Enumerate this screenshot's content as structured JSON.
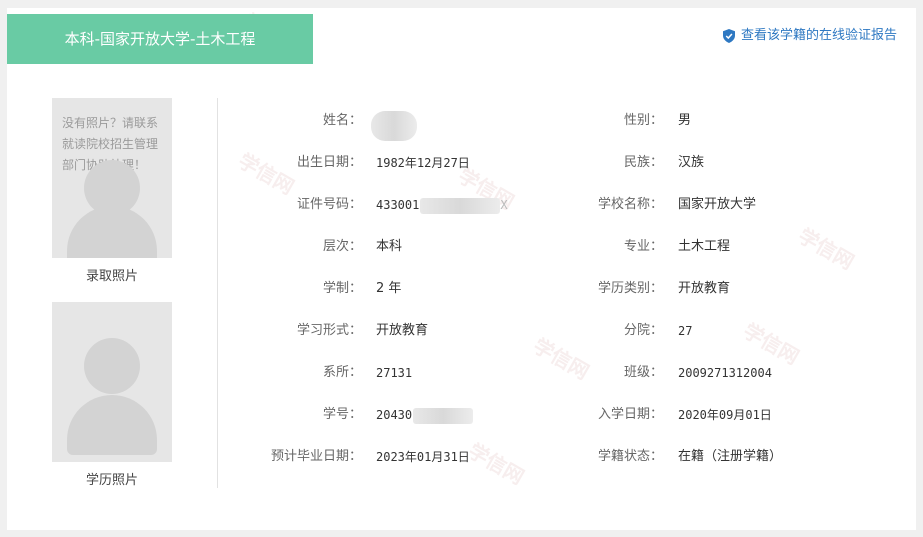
{
  "header": {
    "title": "本科-国家开放大学-土木工程",
    "verify_link": "查看该学籍的在线验证报告"
  },
  "photos": {
    "admission_note": "没有照片？请联系就读院校招生管理部门协助处理！",
    "admission_label": "录取照片",
    "degree_label": "学历照片"
  },
  "fields": {
    "name": {
      "label": "姓名：",
      "value": ""
    },
    "gender": {
      "label": "性别：",
      "value": "男"
    },
    "birth": {
      "label": "出生日期：",
      "value": "1982年12月27日"
    },
    "ethnicity": {
      "label": "民族：",
      "value": "汉族"
    },
    "id_number": {
      "label": "证件号码：",
      "value_prefix": "433001",
      "value_suffix": "X"
    },
    "school": {
      "label": "学校名称：",
      "value": "国家开放大学"
    },
    "level": {
      "label": "层次：",
      "value": "本科"
    },
    "major": {
      "label": "专业：",
      "value": "土木工程"
    },
    "duration": {
      "label": "学制：",
      "value": "2 年"
    },
    "education_type": {
      "label": "学历类别：",
      "value": "开放教育"
    },
    "study_form": {
      "label": "学习形式：",
      "value": "开放教育"
    },
    "branch": {
      "label": "分院：",
      "value": "27"
    },
    "department": {
      "label": "系所：",
      "value": "27131"
    },
    "class": {
      "label": "班级：",
      "value": "2009271312004"
    },
    "student_id": {
      "label": "学号：",
      "value_prefix": "20430"
    },
    "enroll_date": {
      "label": "入学日期：",
      "value": "2020年09月01日"
    },
    "grad_date": {
      "label": "预计毕业日期：",
      "value": "2023年01月31日"
    },
    "status": {
      "label": "学籍状态：",
      "value": "在籍（注册学籍）"
    }
  },
  "watermark": "学信网",
  "colors": {
    "accent": "#69cba4",
    "link": "#2e78c2"
  }
}
